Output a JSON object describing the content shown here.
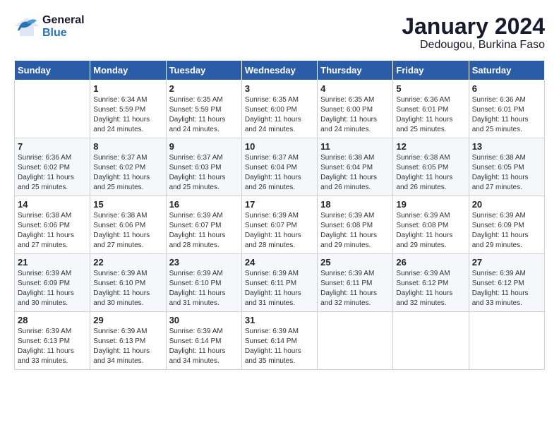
{
  "logo": {
    "line1": "General",
    "line2": "Blue"
  },
  "title": "January 2024",
  "subtitle": "Dedougou, Burkina Faso",
  "days": [
    "Sunday",
    "Monday",
    "Tuesday",
    "Wednesday",
    "Thursday",
    "Friday",
    "Saturday"
  ],
  "weeks": [
    [
      {
        "day": null,
        "info": null
      },
      {
        "day": "1",
        "info": "Sunrise: 6:34 AM\nSunset: 5:59 PM\nDaylight: 11 hours\nand 24 minutes."
      },
      {
        "day": "2",
        "info": "Sunrise: 6:35 AM\nSunset: 5:59 PM\nDaylight: 11 hours\nand 24 minutes."
      },
      {
        "day": "3",
        "info": "Sunrise: 6:35 AM\nSunset: 6:00 PM\nDaylight: 11 hours\nand 24 minutes."
      },
      {
        "day": "4",
        "info": "Sunrise: 6:35 AM\nSunset: 6:00 PM\nDaylight: 11 hours\nand 24 minutes."
      },
      {
        "day": "5",
        "info": "Sunrise: 6:36 AM\nSunset: 6:01 PM\nDaylight: 11 hours\nand 25 minutes."
      },
      {
        "day": "6",
        "info": "Sunrise: 6:36 AM\nSunset: 6:01 PM\nDaylight: 11 hours\nand 25 minutes."
      }
    ],
    [
      {
        "day": "7",
        "info": "Sunrise: 6:36 AM\nSunset: 6:02 PM\nDaylight: 11 hours\nand 25 minutes."
      },
      {
        "day": "8",
        "info": "Sunrise: 6:37 AM\nSunset: 6:02 PM\nDaylight: 11 hours\nand 25 minutes."
      },
      {
        "day": "9",
        "info": "Sunrise: 6:37 AM\nSunset: 6:03 PM\nDaylight: 11 hours\nand 25 minutes."
      },
      {
        "day": "10",
        "info": "Sunrise: 6:37 AM\nSunset: 6:04 PM\nDaylight: 11 hours\nand 26 minutes."
      },
      {
        "day": "11",
        "info": "Sunrise: 6:38 AM\nSunset: 6:04 PM\nDaylight: 11 hours\nand 26 minutes."
      },
      {
        "day": "12",
        "info": "Sunrise: 6:38 AM\nSunset: 6:05 PM\nDaylight: 11 hours\nand 26 minutes."
      },
      {
        "day": "13",
        "info": "Sunrise: 6:38 AM\nSunset: 6:05 PM\nDaylight: 11 hours\nand 27 minutes."
      }
    ],
    [
      {
        "day": "14",
        "info": "Sunrise: 6:38 AM\nSunset: 6:06 PM\nDaylight: 11 hours\nand 27 minutes."
      },
      {
        "day": "15",
        "info": "Sunrise: 6:38 AM\nSunset: 6:06 PM\nDaylight: 11 hours\nand 27 minutes."
      },
      {
        "day": "16",
        "info": "Sunrise: 6:39 AM\nSunset: 6:07 PM\nDaylight: 11 hours\nand 28 minutes."
      },
      {
        "day": "17",
        "info": "Sunrise: 6:39 AM\nSunset: 6:07 PM\nDaylight: 11 hours\nand 28 minutes."
      },
      {
        "day": "18",
        "info": "Sunrise: 6:39 AM\nSunset: 6:08 PM\nDaylight: 11 hours\nand 29 minutes."
      },
      {
        "day": "19",
        "info": "Sunrise: 6:39 AM\nSunset: 6:08 PM\nDaylight: 11 hours\nand 29 minutes."
      },
      {
        "day": "20",
        "info": "Sunrise: 6:39 AM\nSunset: 6:09 PM\nDaylight: 11 hours\nand 29 minutes."
      }
    ],
    [
      {
        "day": "21",
        "info": "Sunrise: 6:39 AM\nSunset: 6:09 PM\nDaylight: 11 hours\nand 30 minutes."
      },
      {
        "day": "22",
        "info": "Sunrise: 6:39 AM\nSunset: 6:10 PM\nDaylight: 11 hours\nand 30 minutes."
      },
      {
        "day": "23",
        "info": "Sunrise: 6:39 AM\nSunset: 6:10 PM\nDaylight: 11 hours\nand 31 minutes."
      },
      {
        "day": "24",
        "info": "Sunrise: 6:39 AM\nSunset: 6:11 PM\nDaylight: 11 hours\nand 31 minutes."
      },
      {
        "day": "25",
        "info": "Sunrise: 6:39 AM\nSunset: 6:11 PM\nDaylight: 11 hours\nand 32 minutes."
      },
      {
        "day": "26",
        "info": "Sunrise: 6:39 AM\nSunset: 6:12 PM\nDaylight: 11 hours\nand 32 minutes."
      },
      {
        "day": "27",
        "info": "Sunrise: 6:39 AM\nSunset: 6:12 PM\nDaylight: 11 hours\nand 33 minutes."
      }
    ],
    [
      {
        "day": "28",
        "info": "Sunrise: 6:39 AM\nSunset: 6:13 PM\nDaylight: 11 hours\nand 33 minutes."
      },
      {
        "day": "29",
        "info": "Sunrise: 6:39 AM\nSunset: 6:13 PM\nDaylight: 11 hours\nand 34 minutes."
      },
      {
        "day": "30",
        "info": "Sunrise: 6:39 AM\nSunset: 6:14 PM\nDaylight: 11 hours\nand 34 minutes."
      },
      {
        "day": "31",
        "info": "Sunrise: 6:39 AM\nSunset: 6:14 PM\nDaylight: 11 hours\nand 35 minutes."
      },
      {
        "day": null,
        "info": null
      },
      {
        "day": null,
        "info": null
      },
      {
        "day": null,
        "info": null
      }
    ]
  ]
}
